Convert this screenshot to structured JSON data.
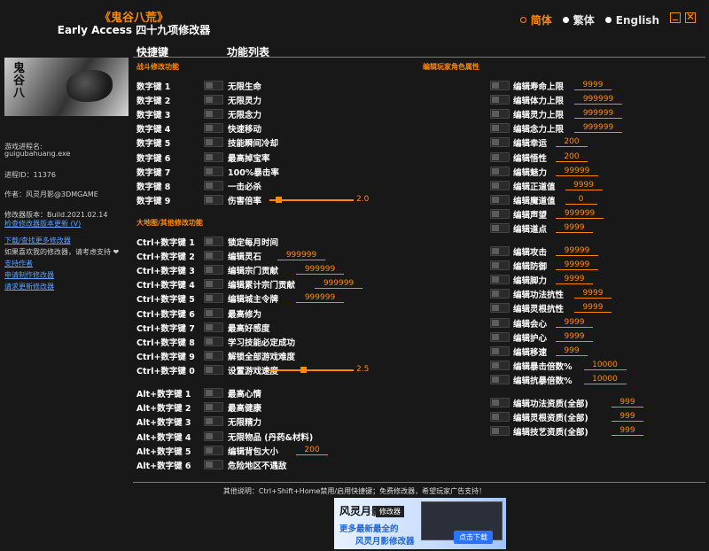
{
  "header": {
    "title_cn": "《鬼谷八荒》",
    "subtitle": "Early Access 四十九项修改器",
    "languages": [
      {
        "label": "简体",
        "selected": true
      },
      {
        "label": "繁体",
        "selected": false
      },
      {
        "label": "English",
        "selected": false
      }
    ],
    "minimize_icon": "minimize-icon",
    "close_icon": "close-icon"
  },
  "columns": {
    "hotkey": "快捷键",
    "features": "功能列表"
  },
  "sidebar": {
    "process_name_label": "游戏进程名:",
    "process_name": "guigubahuang.exe",
    "process_id": "进程ID：11376",
    "author": "作者：风灵月影@3DMGAME",
    "version": "修改器版本：Build.2021.02.14",
    "check_update": "检查修改器版本更新 (V)",
    "links": {
      "download_more": "下载/查找更多修改器",
      "support_note": "如果喜欢我的修改器，请考虑支持 ❤",
      "support_author": "支持作者",
      "request_trainer": "申请制作修改器",
      "request_update": "请求更新修改器"
    }
  },
  "sections": {
    "combat": "战斗修改功能",
    "world": "大地图/其他修改功能",
    "character": "编辑玩家角色属性"
  },
  "combat": [
    {
      "key": "数字键 1",
      "label": "无限生命"
    },
    {
      "key": "数字键 2",
      "label": "无限灵力"
    },
    {
      "key": "数字键 3",
      "label": "无限念力"
    },
    {
      "key": "数字键 4",
      "label": "快速移动"
    },
    {
      "key": "数字键 5",
      "label": "技能瞬间冷却"
    },
    {
      "key": "数字键 6",
      "label": "最高掉宝率"
    },
    {
      "key": "数字键 7",
      "label": "100%暴击率"
    },
    {
      "key": "数字键 8",
      "label": "一击必杀"
    },
    {
      "key": "数字键 9",
      "label": "伤害倍率",
      "slider": "2.0",
      "slider_fraction": 0.1
    }
  ],
  "world": [
    {
      "key": "Ctrl+数字键 1",
      "label": "锁定每月时间"
    },
    {
      "key": "Ctrl+数字键 2",
      "label": "编辑灵石",
      "value": "999999"
    },
    {
      "key": "Ctrl+数字键 3",
      "label": "编辑宗门贡献",
      "value": "999999"
    },
    {
      "key": "Ctrl+数字键 4",
      "label": "编辑累计宗门贡献",
      "value": "999999"
    },
    {
      "key": "Ctrl+数字键 5",
      "label": "编辑城主令牌",
      "value": "999999"
    },
    {
      "key": "Ctrl+数字键 6",
      "label": "最高修为"
    },
    {
      "key": "Ctrl+数字键 7",
      "label": "最高好感度"
    },
    {
      "key": "Ctrl+数字键 8",
      "label": "学习技能必定成功"
    },
    {
      "key": "Ctrl+数字键 9",
      "label": "解锁全部游戏难度"
    },
    {
      "key": "Ctrl+数字键 0",
      "label": "设置游戏速度",
      "slider": "2.5",
      "slider_fraction": 0.4
    }
  ],
  "alt": [
    {
      "key": "Alt+数字键 1",
      "label": "最高心情"
    },
    {
      "key": "Alt+数字键 2",
      "label": "最高健康"
    },
    {
      "key": "Alt+数字键 3",
      "label": "无限精力"
    },
    {
      "key": "Alt+数字键 4",
      "label": "无限物品 (丹药&材料)"
    },
    {
      "key": "Alt+数字键 5",
      "label": "编辑背包大小",
      "value": "200"
    },
    {
      "key": "Alt+数字键 6",
      "label": "危险地区不遇敌"
    }
  ],
  "character": [
    [
      {
        "label": "编辑寿命上限",
        "value": "9999"
      },
      {
        "label": "编辑体力上限",
        "value": "999999"
      },
      {
        "label": "编辑灵力上限",
        "value": "999999"
      },
      {
        "label": "编辑念力上限",
        "value": "999999"
      },
      {
        "label": "编辑幸运",
        "value": "200"
      },
      {
        "label": "编辑悟性",
        "value": "200"
      },
      {
        "label": "编辑魅力",
        "value": "99999"
      },
      {
        "label": "编辑正道值",
        "value": "9999"
      },
      {
        "label": "编辑魔道值",
        "value": "0"
      },
      {
        "label": "编辑声望",
        "value": "999999"
      },
      {
        "label": "编辑道点",
        "value": "9999"
      }
    ],
    [
      {
        "label": "编辑攻击",
        "value": "99999"
      },
      {
        "label": "编辑防御",
        "value": "99999"
      },
      {
        "label": "编辑脚力",
        "value": "9999"
      },
      {
        "label": "编辑功法抗性",
        "value": "9999"
      },
      {
        "label": "编辑灵根抗性",
        "value": "9999"
      },
      {
        "label": "编辑会心",
        "value": "9999"
      },
      {
        "label": "编辑护心",
        "value": "9999"
      },
      {
        "label": "编辑移速",
        "value": "999"
      },
      {
        "label": "编辑暴击倍数%",
        "value": "10000"
      },
      {
        "label": "编辑抗暴倍数%",
        "value": "10000"
      }
    ],
    [
      {
        "label": "编辑功法资质(全部)",
        "value": "999"
      },
      {
        "label": "编辑灵根资质(全部)",
        "value": "999"
      },
      {
        "label": "编辑技艺资质(全部)",
        "value": "999"
      }
    ]
  ],
  "footer": {
    "note": "其他说明：Ctrl+Shift+Home禁用/启用快捷键；免费修改器，希望玩家广告支持！"
  },
  "ad": {
    "logo": "风灵月影",
    "tag": "修改器",
    "line1": "更多最新最全的",
    "line2": "风灵月影修改器",
    "button": "点击下载"
  }
}
